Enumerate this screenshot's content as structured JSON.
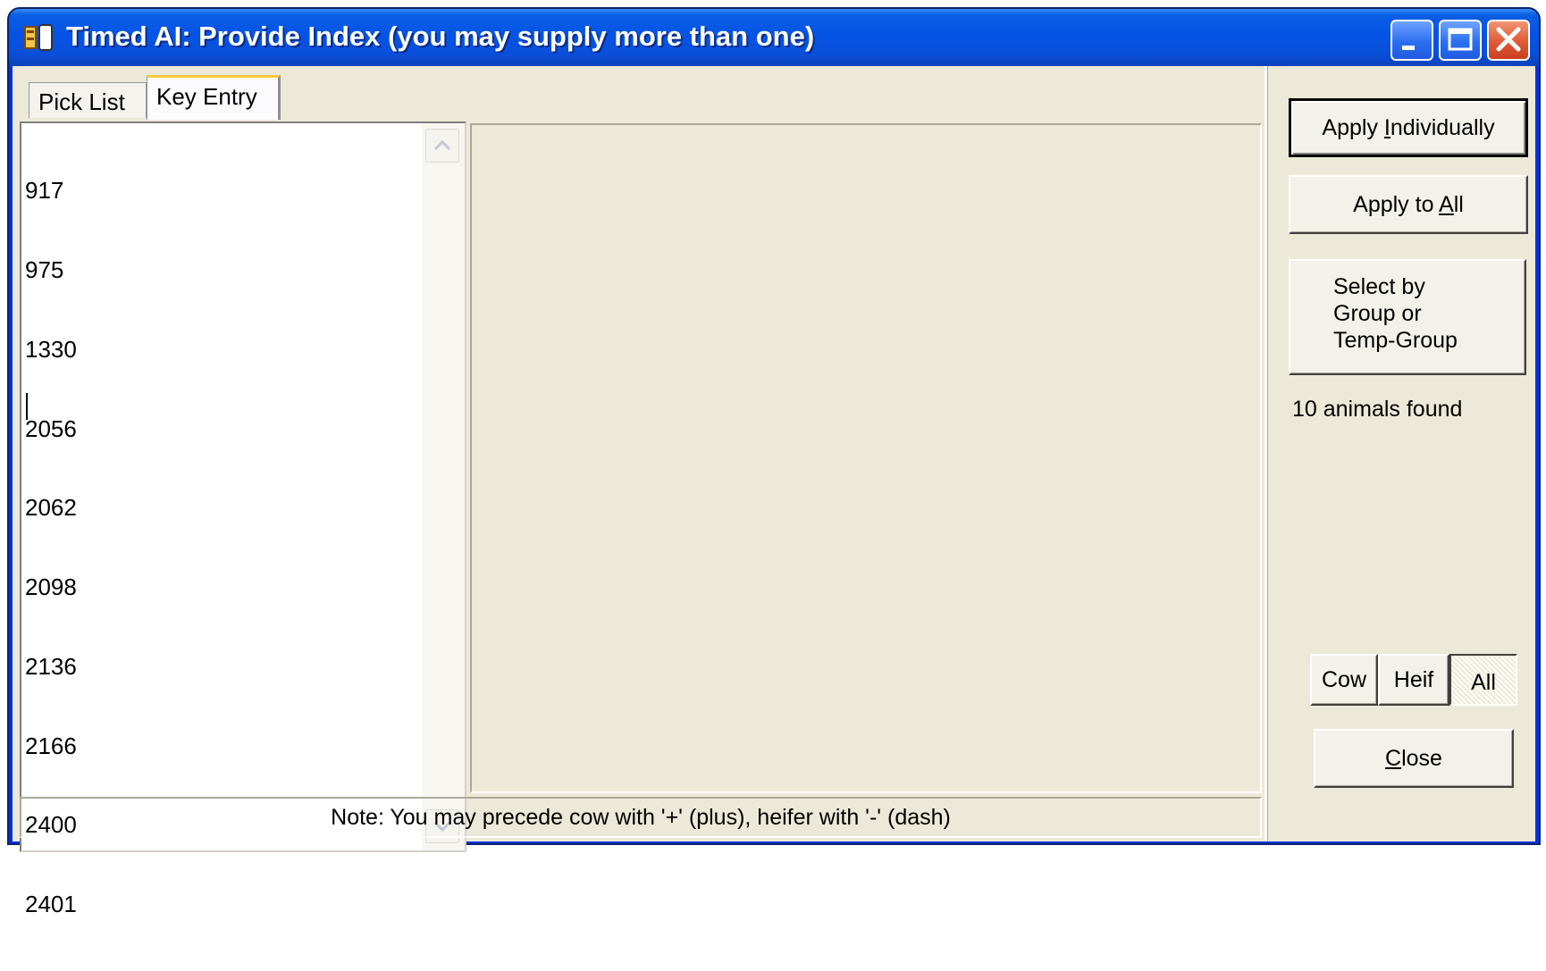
{
  "window": {
    "title": "Timed AI:  Provide Index (you may supply more than one)",
    "icon": "app-icon",
    "controls": [
      "minimize-icon",
      "maximize-icon",
      "close-icon"
    ]
  },
  "tabs": [
    {
      "label": "Pick List",
      "selected": false
    },
    {
      "label": "Key Entry",
      "selected": true
    }
  ],
  "entry": {
    "values": [
      "917",
      "975",
      "1330",
      "2056",
      "2062",
      "2098",
      "2136",
      "2166",
      "2400",
      "2401"
    ]
  },
  "note": "Note: You may precede cow with '+' (plus), heifer with '-' (dash)",
  "actions": {
    "apply_individually_pre": "Apply ",
    "apply_individually_accel": "I",
    "apply_individually_post": "ndividually",
    "apply_all_pre": "Apply to ",
    "apply_all_accel": "A",
    "apply_all_post": "ll",
    "select_group": "Select by\nGroup or\nTemp-Group",
    "found": "10 animals found"
  },
  "filter": {
    "options": [
      "Cow",
      "Heif",
      "All"
    ],
    "selected": "All"
  },
  "close": {
    "accel": "C",
    "rest": "lose"
  },
  "colors": {
    "titlebar": "#0553e6",
    "face": "#ece9d8",
    "close_button": "#e05a36"
  }
}
